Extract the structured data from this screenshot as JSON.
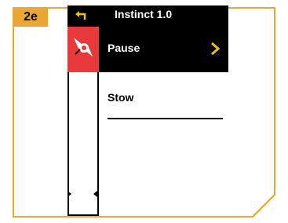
{
  "step_label": "2e",
  "screen": {
    "title": "Instinct 1.0",
    "menu": [
      {
        "label": "Pause",
        "selected": true
      },
      {
        "label": "Stow",
        "selected": false
      }
    ]
  },
  "icons": {
    "back": "back-arrow-icon",
    "propeller": "propeller-icon",
    "chevron": "chevron-right-icon"
  },
  "colors": {
    "badge": "#e8a833",
    "frame": "#e8a833",
    "header_bg": "#000000",
    "highlight_bg": "#e83a3a",
    "chevron": "#f2c200"
  }
}
